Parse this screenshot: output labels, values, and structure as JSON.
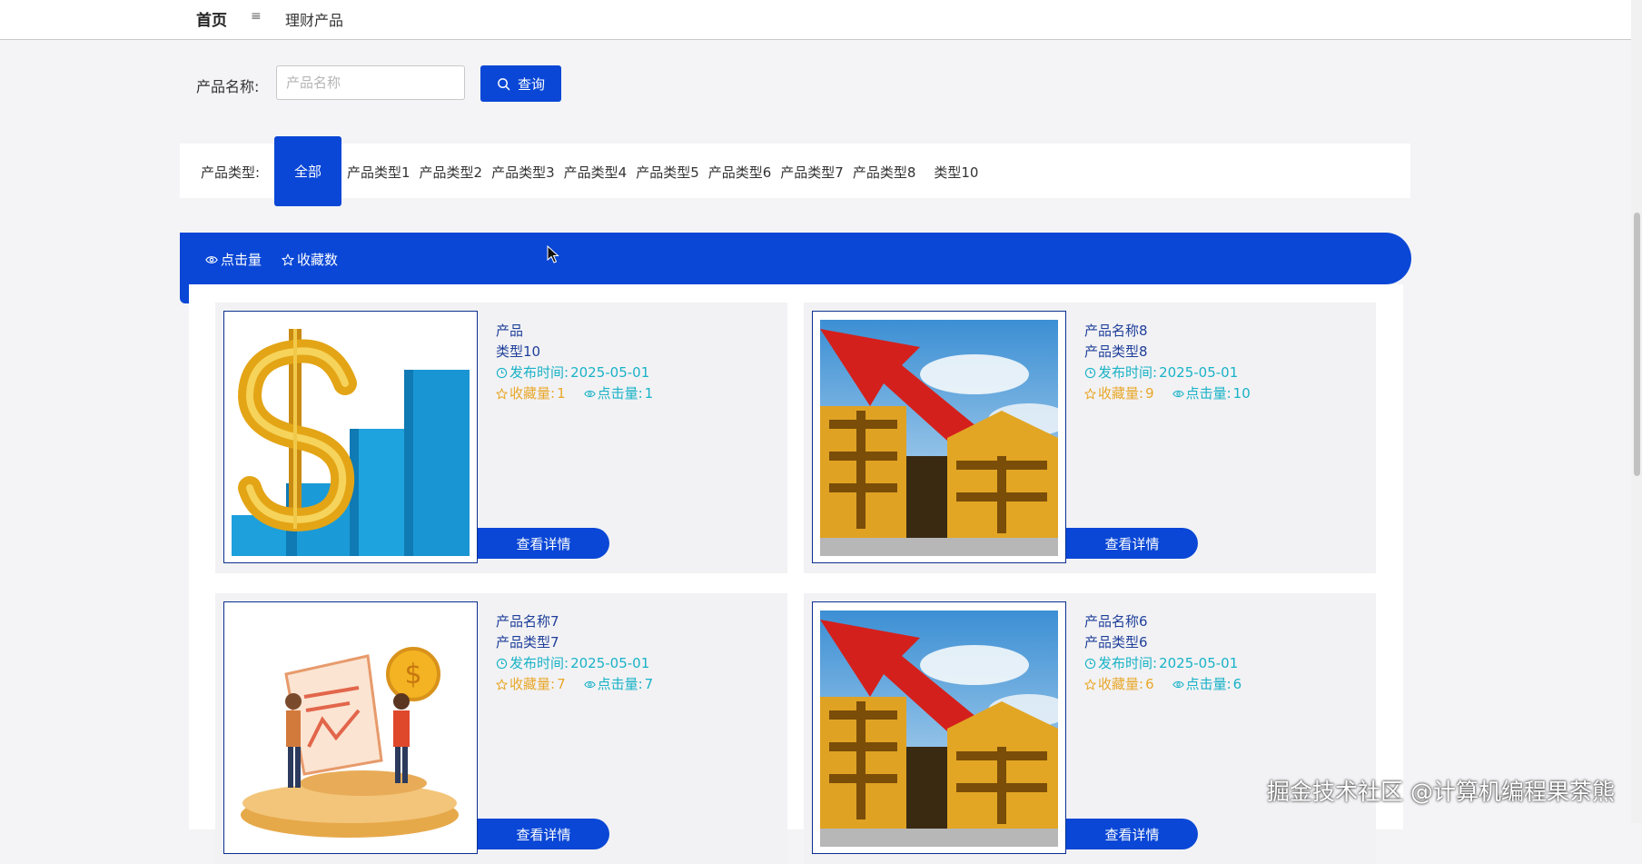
{
  "breadcrumb": {
    "home": "首页",
    "separator": "≡",
    "current": "理财产品"
  },
  "search": {
    "label": "产品名称:",
    "placeholder": "产品名称",
    "value": "",
    "button": "查询",
    "icon": "search-icon"
  },
  "categories": {
    "label": "产品类型:",
    "active": "全部",
    "items": [
      "产品类型1",
      "产品类型2",
      "产品类型3",
      "产品类型4",
      "产品类型5",
      "产品类型6",
      "产品类型7",
      "产品类型8",
      "类型10"
    ]
  },
  "sort": {
    "clicks": "点击量",
    "favorites": "收藏数"
  },
  "products": [
    {
      "name": "产品",
      "type": "类型10",
      "time_label": "发布时间:",
      "time": "2025-05-01",
      "fav_label": "收藏量:",
      "fav": "1",
      "click_label": "点击量:",
      "click": "1",
      "detail": "查看详情",
      "image": "dollar-bar-chart"
    },
    {
      "name": "产品名称8",
      "type": "产品类型8",
      "time_label": "发布时间:",
      "time": "2025-05-01",
      "fav_label": "收藏量:",
      "fav": "9",
      "click_label": "点击量:",
      "click": "10",
      "detail": "查看详情",
      "image": "fund-arrow"
    },
    {
      "name": "产品名称7",
      "type": "产品类型7",
      "time_label": "发布时间:",
      "time": "2025-05-01",
      "fav_label": "收藏量:",
      "fav": "7",
      "click_label": "点击量:",
      "click": "7",
      "detail": "查看详情",
      "image": "investors-coin"
    },
    {
      "name": "产品名称6",
      "type": "产品类型6",
      "time_label": "发布时间:",
      "time": "2025-05-01",
      "fav_label": "收藏量:",
      "fav": "6",
      "click_label": "点击量:",
      "click": "6",
      "detail": "查看详情",
      "image": "fund-arrow"
    }
  ],
  "watermark": "掘金技术社区 @计算机编程果茶熊",
  "colors": {
    "primary": "#0a47d6",
    "favorite": "#e8a72a",
    "info": "#19b2c7",
    "title": "#1f3f9a"
  }
}
